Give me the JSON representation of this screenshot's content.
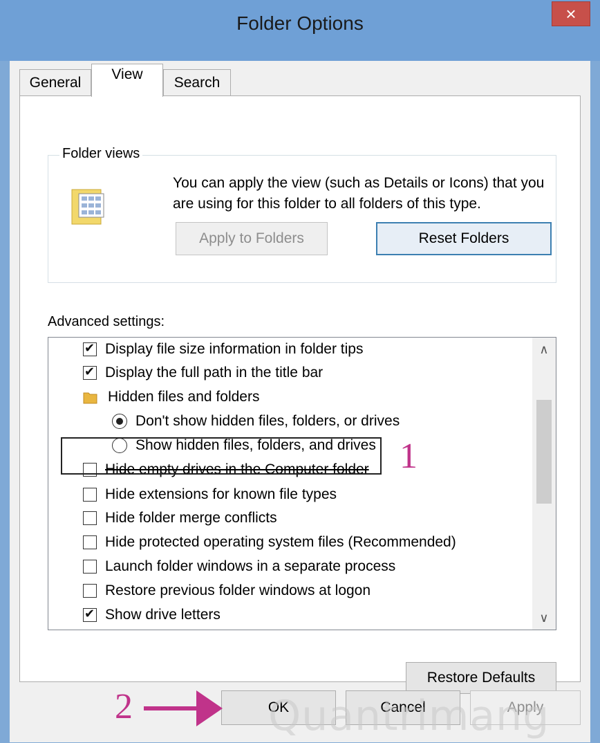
{
  "window": {
    "title": "Folder Options",
    "close_symbol": "×"
  },
  "tabs": [
    {
      "label": "General"
    },
    {
      "label": "View"
    },
    {
      "label": "Search"
    }
  ],
  "folder_views": {
    "label": "Folder views",
    "description": "You can apply the view (such as Details or Icons) that you are using for this folder to all folders of this type.",
    "apply_button": "Apply to Folders",
    "reset_button": "Reset Folders"
  },
  "advanced": {
    "label": "Advanced settings:",
    "items": [
      {
        "text": "Display file size information in folder tips",
        "type": "checkbox",
        "checked": true
      },
      {
        "text": "Display the full path in the title bar",
        "type": "checkbox",
        "checked": true
      },
      {
        "text": "Hidden files and folders",
        "type": "folder"
      },
      {
        "text": "Don't show hidden files, folders, or drives",
        "type": "radio",
        "selected": true
      },
      {
        "text": "Show hidden files, folders, and drives",
        "type": "radio",
        "selected": false
      },
      {
        "text": "Hide empty drives in the Computer folder",
        "type": "checkbox",
        "checked": false
      },
      {
        "text": "Hide extensions for known file types",
        "type": "checkbox",
        "checked": false
      },
      {
        "text": "Hide folder merge conflicts",
        "type": "checkbox",
        "checked": false
      },
      {
        "text": "Hide protected operating system files (Recommended)",
        "type": "checkbox",
        "checked": false
      },
      {
        "text": "Launch folder windows in a separate process",
        "type": "checkbox",
        "checked": false
      },
      {
        "text": "Restore previous folder windows at logon",
        "type": "checkbox",
        "checked": false
      },
      {
        "text": "Show drive letters",
        "type": "checkbox",
        "checked": true
      }
    ],
    "restore_defaults": "Restore Defaults"
  },
  "footer": {
    "ok": "OK",
    "cancel": "Cancel",
    "apply": "Apply"
  },
  "annotations": {
    "step1": "1",
    "step2": "2"
  },
  "watermark": "Quantrimang",
  "colors": {
    "annotation": "#c0338a",
    "titlebar": "#6fa0d6",
    "close": "#c7504a"
  }
}
